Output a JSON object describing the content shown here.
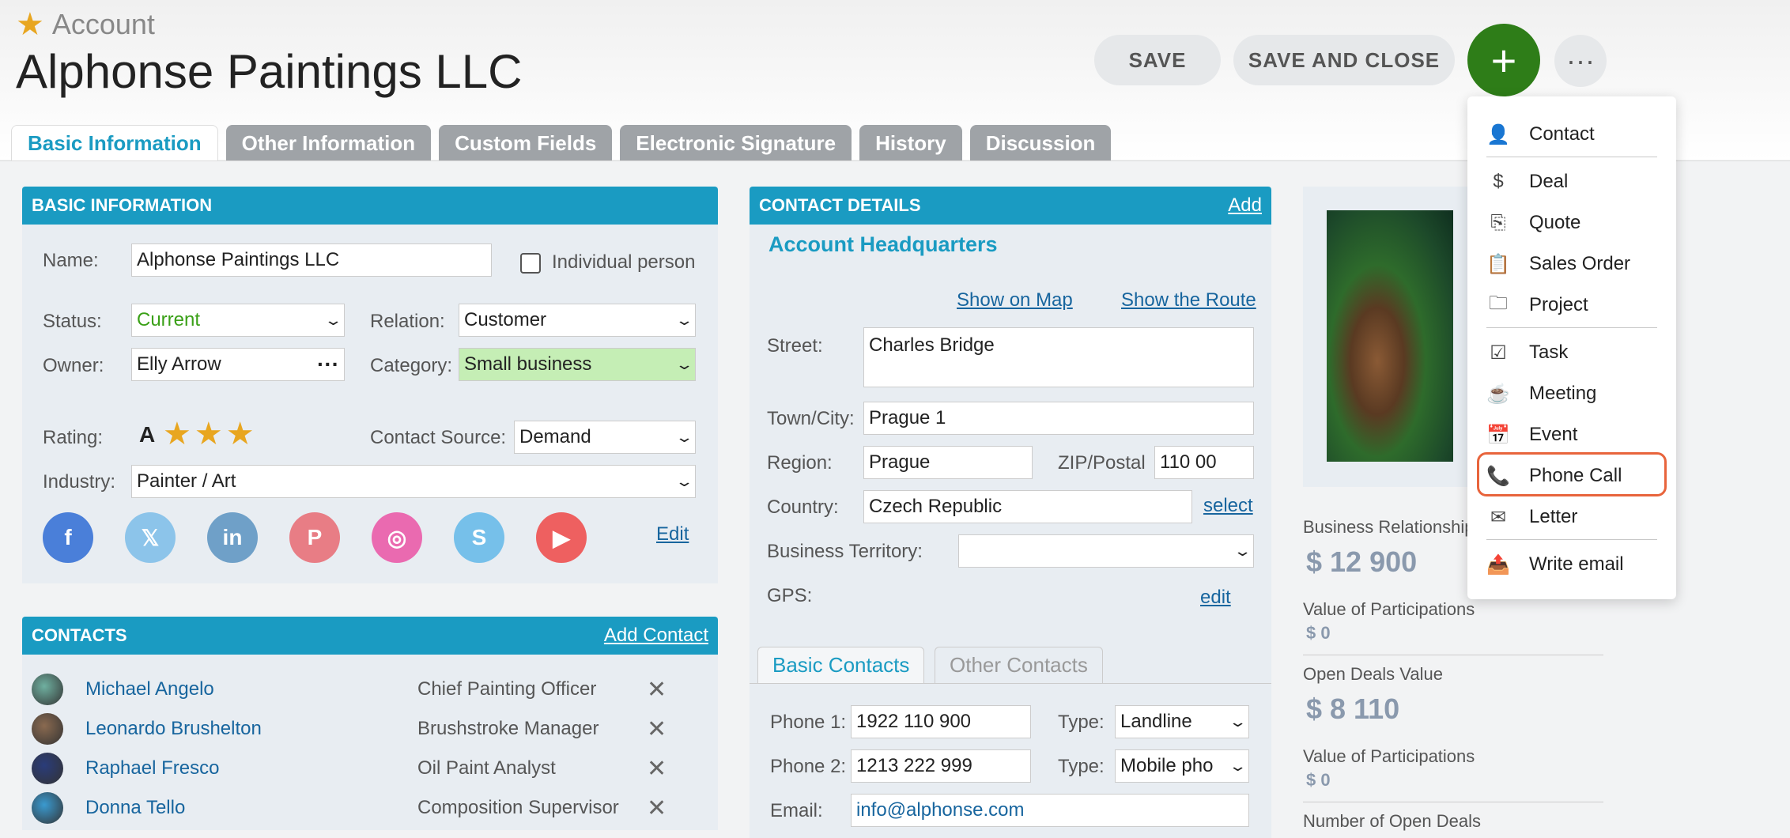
{
  "header": {
    "breadcrumb": "Account",
    "title": "Alphonse Paintings LLC",
    "save_label": "SAVE",
    "save_close_label": "SAVE AND CLOSE",
    "plus_label": "+",
    "more_label": "···"
  },
  "tabs": [
    {
      "label": "Basic Information"
    },
    {
      "label": "Other Information"
    },
    {
      "label": "Custom Fields"
    },
    {
      "label": "Electronic Signature"
    },
    {
      "label": "History"
    },
    {
      "label": "Discussion"
    }
  ],
  "basic": {
    "heading": "BASIC INFORMATION",
    "name_label": "Name:",
    "name_value": "Alphonse Paintings LLC",
    "individual_label": "Individual person",
    "status_label": "Status:",
    "status_value": "Current",
    "relation_label": "Relation:",
    "relation_value": "Customer",
    "owner_label": "Owner:",
    "owner_value": "Elly Arrow",
    "category_label": "Category:",
    "category_value": "Small business",
    "rating_label": "Rating:",
    "rating_grade": "A",
    "rating_stars": 3,
    "source_label": "Contact Source:",
    "source_value": "Demand",
    "industry_label": "Industry:",
    "industry_value": "Painter / Art",
    "edit_label": "Edit",
    "status_color": "#3aa017",
    "category_bg": "#c5eeb5"
  },
  "social": [
    {
      "icon": "facebook-icon",
      "glyph": "f",
      "color": "#4a7fd9"
    },
    {
      "icon": "x-icon",
      "glyph": "𝕏",
      "color": "#8cc4ea"
    },
    {
      "icon": "linkedin-icon",
      "glyph": "in",
      "color": "#6fa0c8"
    },
    {
      "icon": "pinterest-icon",
      "glyph": "P",
      "color": "#e87d85"
    },
    {
      "icon": "instagram-icon",
      "glyph": "◎",
      "color": "#ea6ab0"
    },
    {
      "icon": "skype-icon",
      "glyph": "S",
      "color": "#76c0ea"
    },
    {
      "icon": "youtube-icon",
      "glyph": "▶",
      "color": "#ee6060"
    }
  ],
  "contacts": {
    "heading": "CONTACTS",
    "add_label": "Add Contact",
    "rows": [
      {
        "name": "Michael Angelo",
        "role": "Chief Painting Officer",
        "avatar": "#6fb0a0"
      },
      {
        "name": "Leonardo Brushelton",
        "role": "Brushstroke Manager",
        "avatar": "#8a6a50"
      },
      {
        "name": "Raphael Fresco",
        "role": "Oil Paint Analyst",
        "avatar": "#2a3c7a"
      },
      {
        "name": "Donna Tello",
        "role": "Composition Supervisor",
        "avatar": "#3a9ad0"
      }
    ],
    "remove_glyph": "✕"
  },
  "contact_details": {
    "heading": "CONTACT DETAILS",
    "add_label": "Add",
    "subheading": "Account Headquarters",
    "show_map": "Show on Map",
    "show_route": "Show the Route",
    "street_label": "Street:",
    "street_value": "Charles Bridge",
    "town_label": "Town/City:",
    "town_value": "Prague 1",
    "region_label": "Region:",
    "region_value": "Prague",
    "zip_label": "ZIP/Postal",
    "zip_value": "110 00",
    "country_label": "Country:",
    "country_value": "Czech Republic",
    "select_label": "select",
    "territory_label": "Business Territory:",
    "gps_label": "GPS:",
    "gps_edit": "edit",
    "subtab_basic": "Basic Contacts",
    "subtab_other": "Other Contacts",
    "phone1_label": "Phone 1:",
    "phone1_value": "1922 110 900",
    "type_label": "Type:",
    "phone1_type": "Landline",
    "phone2_label": "Phone 2:",
    "phone2_value": "1213 222 999",
    "phone2_type": "Mobile pho",
    "email_label": "Email:",
    "email_value": "info@alphonse.com"
  },
  "stats": {
    "business_label": "Business Relationship",
    "business_value": "$ 12 900",
    "participations_label": "Value of Participations",
    "participations_value": "$ 0",
    "open_deals_label": "Open Deals Value",
    "open_deals_value": "$ 8 110",
    "participations2_label": "Value of Participations",
    "participations2_value": "$ 0",
    "num_open_label": "Number of Open Deals"
  },
  "menu": {
    "items": [
      {
        "label": "Contact",
        "icon": "person-icon",
        "glyph": "👤"
      },
      {
        "label": "Deal",
        "icon": "dollar-icon",
        "glyph": "$"
      },
      {
        "label": "Quote",
        "icon": "quote-icon",
        "glyph": "⎘"
      },
      {
        "label": "Sales Order",
        "icon": "clipboard-icon",
        "glyph": "📋"
      },
      {
        "label": "Project",
        "icon": "folder-icon",
        "glyph": "🗀"
      },
      {
        "label": "Task",
        "icon": "task-icon",
        "glyph": "☑"
      },
      {
        "label": "Meeting",
        "icon": "cup-icon",
        "glyph": "☕"
      },
      {
        "label": "Event",
        "icon": "calendar-icon",
        "glyph": "📅"
      },
      {
        "label": "Phone Call",
        "icon": "phone-icon",
        "glyph": "📞"
      },
      {
        "label": "Letter",
        "icon": "envelope-icon",
        "glyph": "✉"
      },
      {
        "label": "Write email",
        "icon": "email-send-icon",
        "glyph": "📤"
      }
    ],
    "highlight_color": "#e8643c"
  },
  "colors": {
    "accent": "#1a9bc2",
    "plus_button": "#2e7d18",
    "link": "#17659e"
  }
}
